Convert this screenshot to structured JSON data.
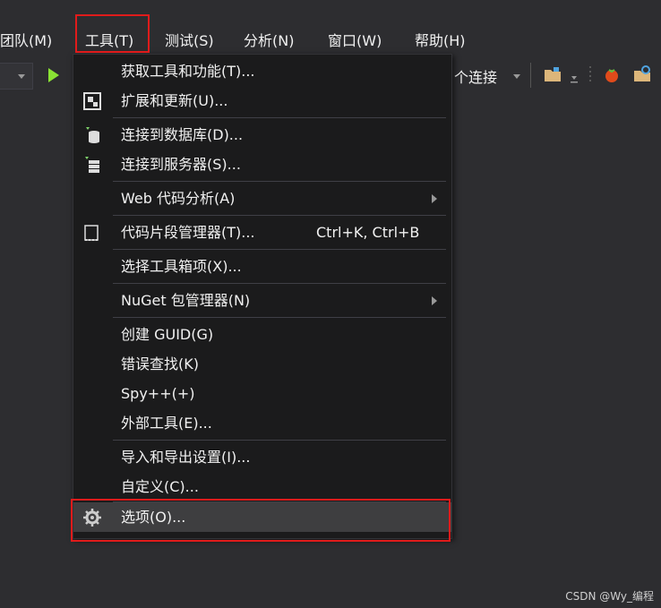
{
  "menubar": {
    "items": [
      {
        "label": "团队(M)"
      },
      {
        "label": "工具(T)"
      },
      {
        "label": "测试(S)"
      },
      {
        "label": "分析(N)"
      },
      {
        "label": "窗口(W)"
      },
      {
        "label": "帮助(H)"
      }
    ]
  },
  "toolbar": {
    "connection_label": "个连接"
  },
  "tools_menu": {
    "items": [
      {
        "label": "获取工具和功能(T)..."
      },
      {
        "label": "扩展和更新(U)...",
        "icon": "extensions-icon"
      },
      {
        "label": "连接到数据库(D)...",
        "icon": "database-icon"
      },
      {
        "label": "连接到服务器(S)...",
        "icon": "server-icon"
      },
      {
        "label": "Web 代码分析(A)"
      },
      {
        "label": "代码片段管理器(T)...",
        "shortcut": "Ctrl+K, Ctrl+B",
        "icon": "snippet-icon"
      },
      {
        "label": "选择工具箱项(X)..."
      },
      {
        "label": "NuGet 包管理器(N)"
      },
      {
        "label": "创建 GUID(G)"
      },
      {
        "label": "错误查找(K)"
      },
      {
        "label": "Spy++(+)"
      },
      {
        "label": "外部工具(E)..."
      },
      {
        "label": "导入和导出设置(I)..."
      },
      {
        "label": "自定义(C)..."
      },
      {
        "label": "选项(O)...",
        "icon": "gear-icon"
      }
    ]
  },
  "colors": {
    "background": "#2d2d30",
    "menu_background": "#1b1b1c",
    "highlight": "#e01b1b",
    "play_green": "#8ae234"
  },
  "watermark": "CSDN @Wy_编程"
}
